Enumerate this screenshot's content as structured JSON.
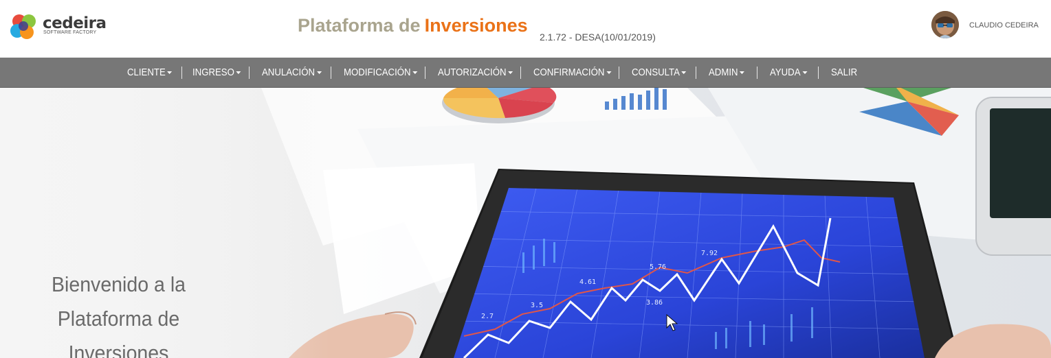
{
  "brand": {
    "name": "cedeira",
    "subtitle": "SOFTWARE FACTORY"
  },
  "header": {
    "title_part1": "Plataforma de",
    "title_part2": "Inversiones",
    "version": "2.1.72 - DESA(10/01/2019)",
    "user_name": "CLAUDIO CEDEIRA"
  },
  "nav": {
    "items": [
      {
        "label": "CLIENTE",
        "dropdown": true
      },
      {
        "label": "INGRESO",
        "dropdown": true
      },
      {
        "label": "ANULACIÓN",
        "dropdown": true
      },
      {
        "label": "MODIFICACIÓN",
        "dropdown": true
      },
      {
        "label": "AUTORIZACIÓN",
        "dropdown": true
      },
      {
        "label": "CONFIRMACIÓN",
        "dropdown": true
      },
      {
        "label": "CONSULTA",
        "dropdown": true
      },
      {
        "label": "ADMIN",
        "dropdown": true
      },
      {
        "label": "AYUDA",
        "dropdown": true
      },
      {
        "label": "SALIR",
        "dropdown": false
      }
    ]
  },
  "hero": {
    "welcome_line1": "Bienvenido a la",
    "welcome_line2": "Plataforma de Inversiones",
    "image_labels": [
      "2.7",
      "3.5",
      "4.61",
      "5.76",
      "3.86",
      "7.92"
    ]
  },
  "colors": {
    "nav_bg": "#777777",
    "title_gray": "#a9a48e",
    "title_orange": "#ea7218",
    "screen_blue": "#2a44d8"
  }
}
